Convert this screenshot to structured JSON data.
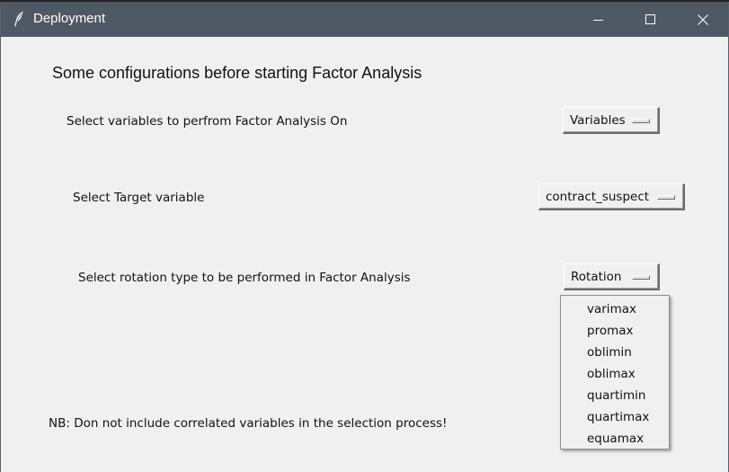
{
  "window": {
    "title": "Deployment",
    "icon": "feather-icon",
    "controls": [
      "minimize-icon",
      "maximize-icon",
      "close-icon"
    ]
  },
  "main": {
    "heading": "Some configurations before starting Factor Analysis",
    "rows": [
      {
        "label": "Select variables to perfrom Factor Analysis On",
        "value": "Variables"
      },
      {
        "label": "Select Target variable",
        "value": "contract_suspect"
      },
      {
        "label": "Select rotation type to be performed in Factor Analysis",
        "value": "Rotation"
      }
    ],
    "rotation_options": [
      "varimax",
      "promax",
      "oblimin",
      "oblimax",
      "quartimin",
      "quartimax",
      "equamax"
    ],
    "note": "NB: Don not include correlated variables in the selection process!"
  },
  "colors": {
    "titlebar": "#4f5966",
    "background": "#f0f0f0",
    "text": "#111111"
  }
}
